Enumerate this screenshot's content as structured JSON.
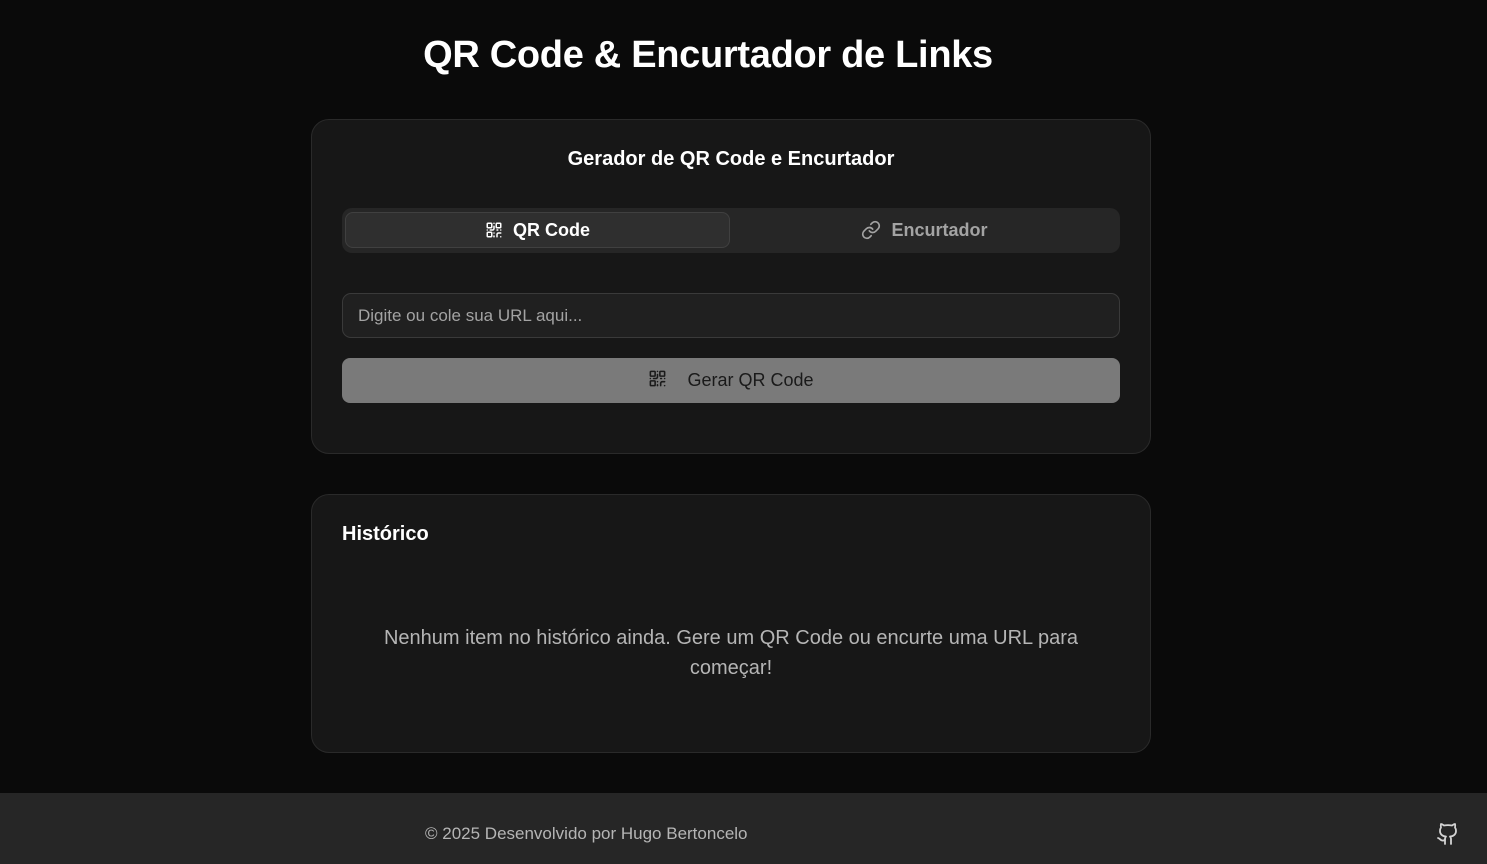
{
  "page": {
    "title": "QR Code & Encurtador de Links"
  },
  "generator": {
    "title": "Gerador de QR Code e Encurtador",
    "tabs": [
      {
        "label": "QR Code",
        "icon": "qr-code-icon",
        "active": true
      },
      {
        "label": "Encurtador",
        "icon": "link-icon",
        "active": false
      }
    ],
    "input": {
      "placeholder": "Digite ou cole sua URL aqui...",
      "value": ""
    },
    "button": {
      "label": "Gerar QR Code",
      "icon": "qr-code-icon"
    }
  },
  "history": {
    "title": "Histórico",
    "empty_message": "Nenhum item no histórico ainda. Gere um QR Code ou encurte uma URL para começar!"
  },
  "footer": {
    "text": "© 2025 Desenvolvido por Hugo Bertoncelo",
    "icon": "github-icon"
  },
  "colors": {
    "background": "#0a0a0a",
    "card": "#171717",
    "button_disabled": "#7a7a7a",
    "footer": "#262626"
  }
}
